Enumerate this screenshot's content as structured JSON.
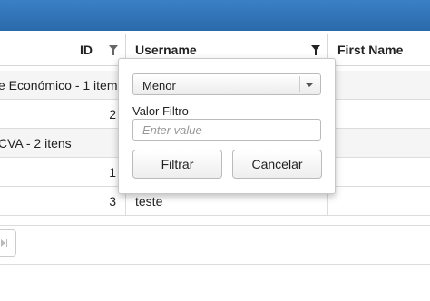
{
  "grid": {
    "columns": [
      {
        "label": "ID"
      },
      {
        "label": "Username"
      },
      {
        "label": "First Name"
      }
    ],
    "rows": [
      {
        "type": "group",
        "text": "e Económico - 1 item"
      },
      {
        "type": "data",
        "id": "2",
        "username": ""
      },
      {
        "type": "group",
        "text": "CVA - 2 itens"
      },
      {
        "type": "data",
        "id": "1",
        "username": ""
      },
      {
        "type": "data",
        "id": "3",
        "username": "teste"
      }
    ]
  },
  "filter_popup": {
    "operator": "Menor",
    "value_label": "Valor Filtro",
    "value_placeholder": "Enter value",
    "value": "",
    "apply_label": "Filtrar",
    "cancel_label": "Cancelar"
  },
  "colors": {
    "header_bar": "#2f72b6"
  }
}
